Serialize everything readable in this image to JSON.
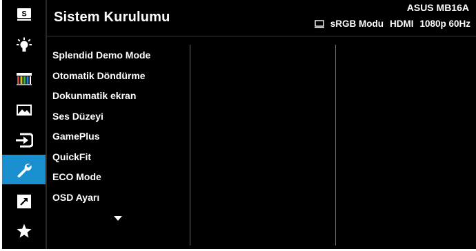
{
  "header": {
    "title": "Sistem Kurulumu",
    "model": "ASUS MB16A",
    "mode": "sRGB Modu",
    "input": "HDMI",
    "resolution": "1080p 60Hz"
  },
  "rail": {
    "items": [
      {
        "icon": "splendid-icon",
        "glyph": "S",
        "active": false
      },
      {
        "icon": "blue-light-filter-icon",
        "active": false
      },
      {
        "icon": "color-icon",
        "active": false
      },
      {
        "icon": "image-icon",
        "active": false
      },
      {
        "icon": "input-select-icon",
        "active": false
      },
      {
        "icon": "wrench-icon",
        "active": true
      },
      {
        "icon": "shortcut-icon",
        "active": false
      },
      {
        "icon": "star-icon",
        "active": false
      }
    ],
    "accent_color": "#1a8fd0"
  },
  "menu": {
    "items": [
      "Splendid Demo Mode",
      "Otomatik Döndürme",
      "Dokunmatik ekran",
      "Ses Düzeyi",
      "GamePlus",
      "QuickFit",
      "ECO Mode",
      "OSD Ayarı"
    ]
  }
}
